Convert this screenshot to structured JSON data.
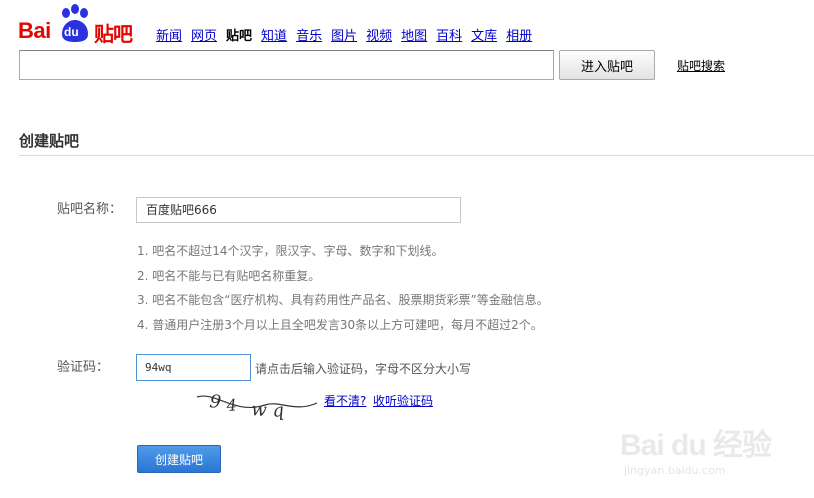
{
  "logo": {
    "bai": "Bai",
    "du": "du",
    "tieba": "贴吧"
  },
  "nav": [
    {
      "label": "新闻",
      "active": false
    },
    {
      "label": "网页",
      "active": false
    },
    {
      "label": "贴吧",
      "active": true
    },
    {
      "label": "知道",
      "active": false
    },
    {
      "label": "音乐",
      "active": false
    },
    {
      "label": "图片",
      "active": false
    },
    {
      "label": "视频",
      "active": false
    },
    {
      "label": "地图",
      "active": false
    },
    {
      "label": "百科",
      "active": false
    },
    {
      "label": "文库",
      "active": false
    },
    {
      "label": "相册",
      "active": false
    }
  ],
  "search": {
    "value": "",
    "button_label": "进入贴吧",
    "tieba_search_link": "贴吧搜索"
  },
  "form": {
    "section_title": "创建贴吧",
    "name_label": "贴吧名称：",
    "name_value": "百度贴吧666",
    "rules": [
      "1. 吧名不超过14个汉字，限汉字、字母、数字和下划线。",
      "2. 吧名不能与已有贴吧名称重复。",
      "3. 吧名不能包含“医疗机构、具有药用性产品名、股票期货彩票”等金融信息。",
      "4. 普通用户注册3个月以上且全吧发言30条以上方可建吧，每月不超过2个。"
    ],
    "captcha_label": "验证码：",
    "captcha_value": "94wq",
    "captcha_hint": "请点击后输入验证码，字母不区分大小写",
    "captcha_image_text": "94wq",
    "cant_see_link": "看不清?",
    "listen_link": "收听验证码",
    "create_button": "创建贴吧"
  },
  "watermark": {
    "text": "Bai du 经验",
    "sub": "jingyan.baidu.com"
  },
  "colors": {
    "brand_red": "#e10601",
    "paw_blue": "#2932e1",
    "link_blue": "#0000cc",
    "button_blue": "#3385ff"
  }
}
